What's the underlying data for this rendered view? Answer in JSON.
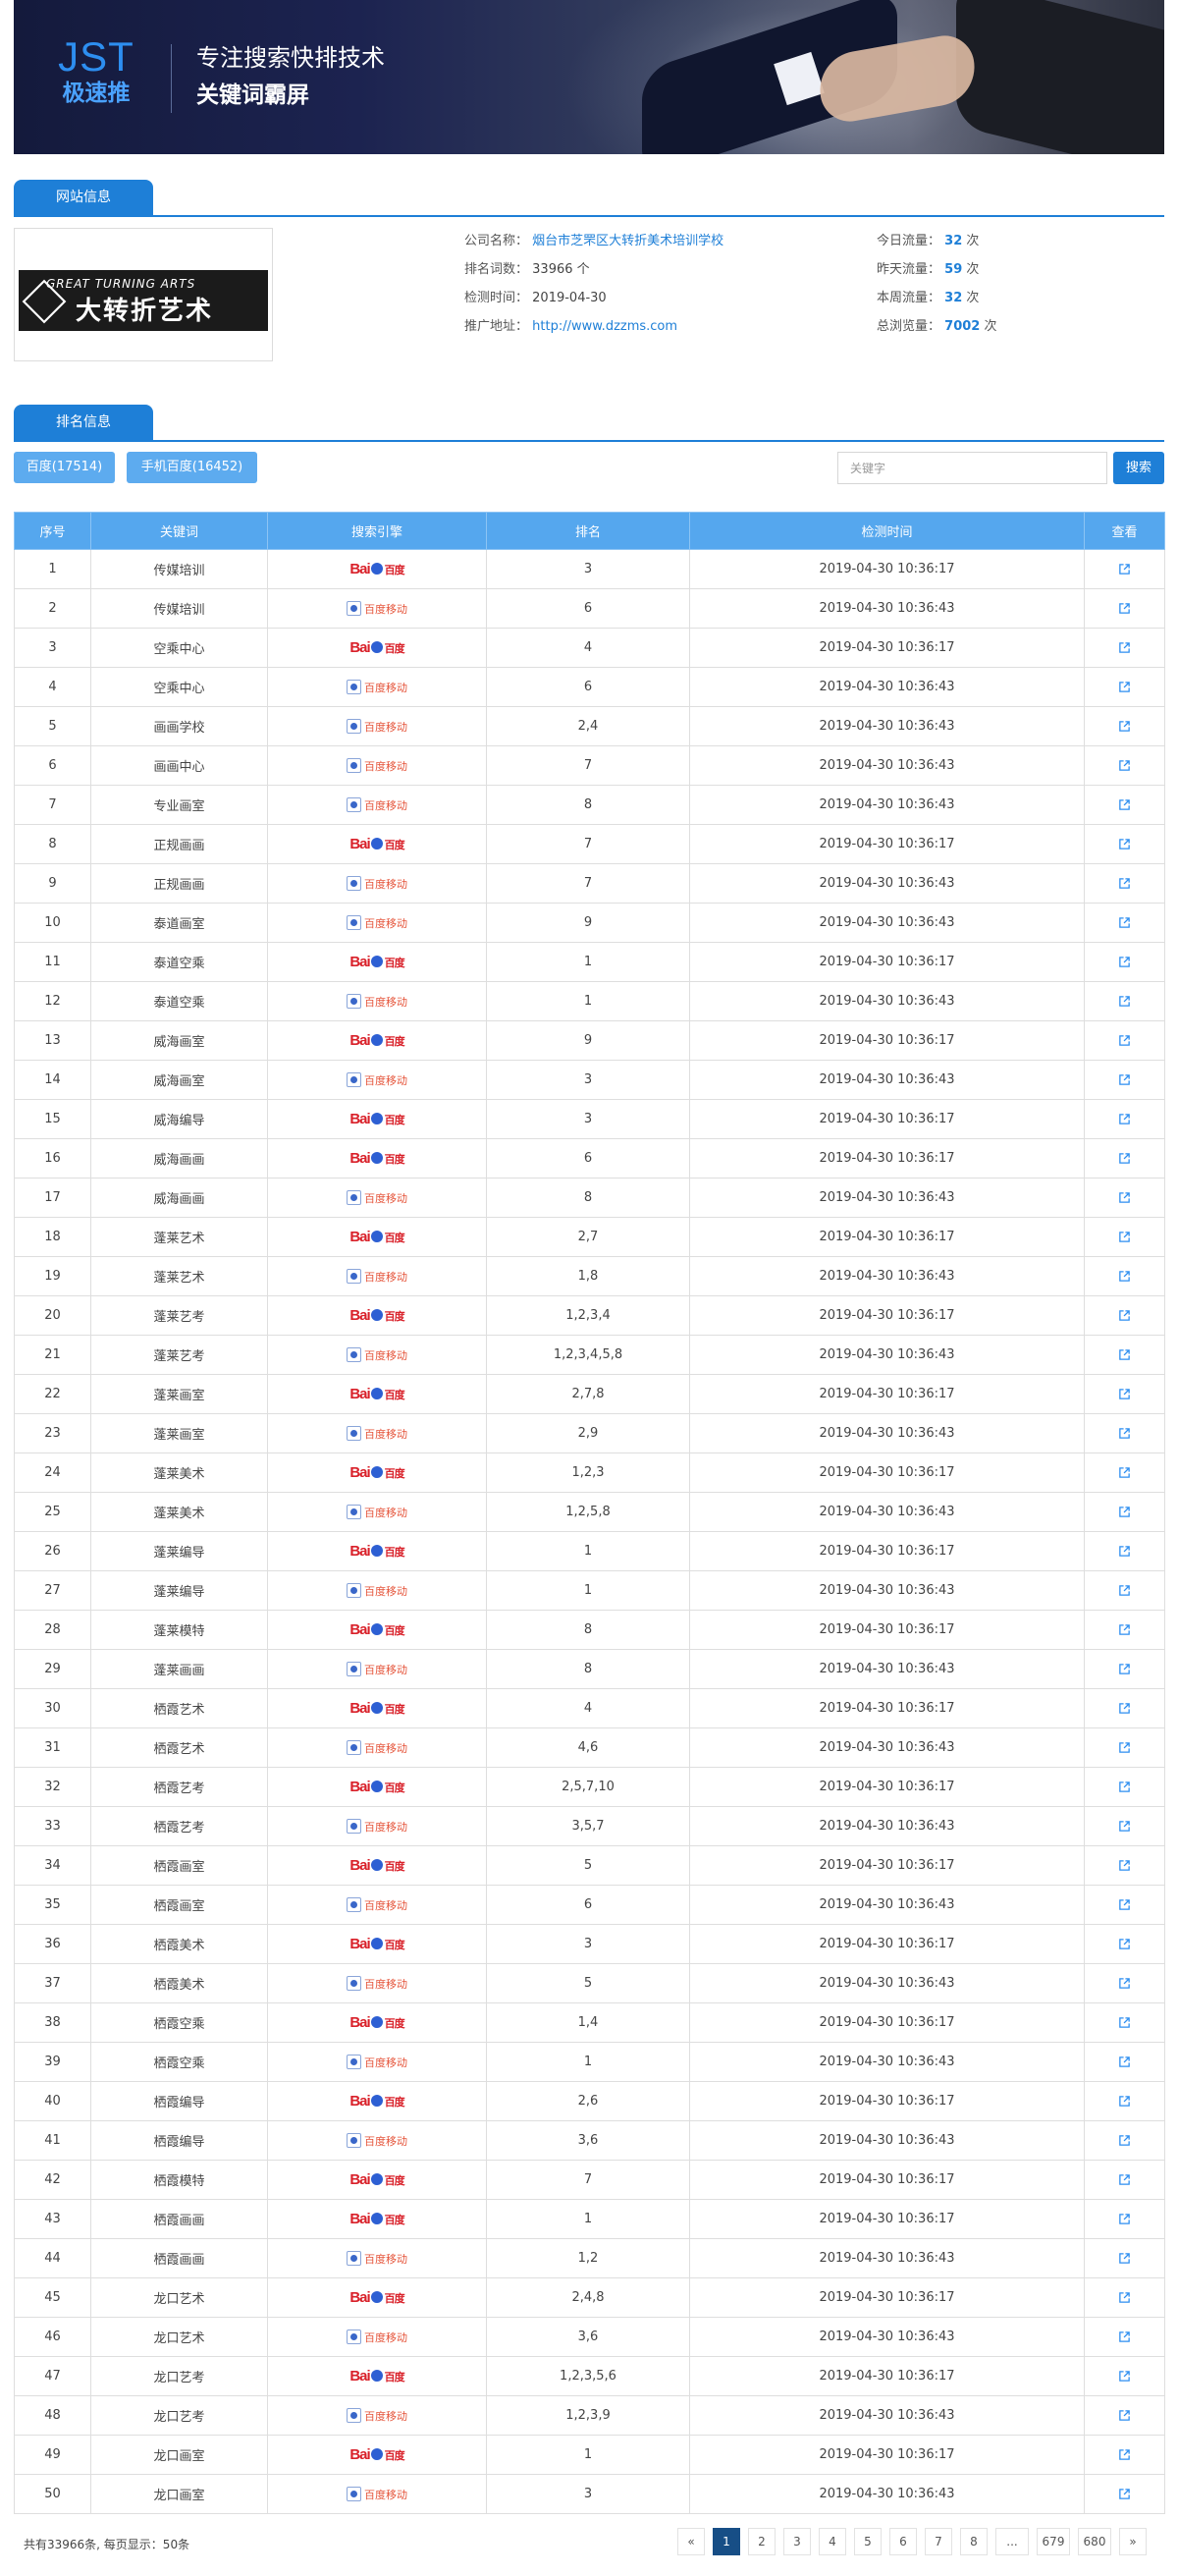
{
  "banner": {
    "logo_main": "JST",
    "logo_sub": "极速推",
    "slogan_line1": "专注搜索快排技术",
    "slogan_line2": "关键词霸屏"
  },
  "site_section": {
    "tab_label": "网站信息"
  },
  "site_logo": {
    "text_en": "GREAT TURNING ARTS",
    "text_cn": "大转折艺术"
  },
  "site_info": {
    "company_label": "公司名称：",
    "company_value": "烟台市芝罘区大转折美术培训学校",
    "rank_count_label": "排名词数：",
    "rank_count_value": "33966 个",
    "check_time_label": "检测时间：",
    "check_time_value": "2019-04-30",
    "url_label": "推广地址：",
    "url_value": "http://www.dzzms.com"
  },
  "traffic": {
    "today_label": "今日流量：",
    "today_value": "32",
    "today_unit": "次",
    "yesterday_label": "昨天流量：",
    "yesterday_value": "59",
    "yesterday_unit": "次",
    "week_label": "本周流量：",
    "week_value": "32",
    "week_unit": "次",
    "total_label": "总浏览量：",
    "total_value": "7002",
    "total_unit": "次"
  },
  "rank_section": {
    "tab_label": "排名信息"
  },
  "filters": {
    "baidu": "百度(17514)",
    "mobile": "手机百度(16452)"
  },
  "search": {
    "placeholder": "关键字",
    "button": "搜索"
  },
  "table": {
    "headers": [
      "序号",
      "关键词",
      "搜索引擎",
      "排名",
      "检测时间",
      "查看"
    ],
    "engine_labels": {
      "baidu_cn": "百度",
      "mobile_cn": "百度移动"
    },
    "rows": [
      [
        "1",
        "传媒培训",
        "baidu",
        "3",
        "2019-04-30 10:36:17"
      ],
      [
        "2",
        "传媒培训",
        "mobile",
        "6",
        "2019-04-30 10:36:43"
      ],
      [
        "3",
        "空乘中心",
        "baidu",
        "4",
        "2019-04-30 10:36:17"
      ],
      [
        "4",
        "空乘中心",
        "mobile",
        "6",
        "2019-04-30 10:36:43"
      ],
      [
        "5",
        "画画学校",
        "mobile",
        "2,4",
        "2019-04-30 10:36:43"
      ],
      [
        "6",
        "画画中心",
        "mobile",
        "7",
        "2019-04-30 10:36:43"
      ],
      [
        "7",
        "专业画室",
        "mobile",
        "8",
        "2019-04-30 10:36:43"
      ],
      [
        "8",
        "正规画画",
        "baidu",
        "7",
        "2019-04-30 10:36:17"
      ],
      [
        "9",
        "正规画画",
        "mobile",
        "7",
        "2019-04-30 10:36:43"
      ],
      [
        "10",
        "泰道画室",
        "mobile",
        "9",
        "2019-04-30 10:36:43"
      ],
      [
        "11",
        "泰道空乘",
        "baidu",
        "1",
        "2019-04-30 10:36:17"
      ],
      [
        "12",
        "泰道空乘",
        "mobile",
        "1",
        "2019-04-30 10:36:43"
      ],
      [
        "13",
        "威海画室",
        "baidu",
        "9",
        "2019-04-30 10:36:17"
      ],
      [
        "14",
        "威海画室",
        "mobile",
        "3",
        "2019-04-30 10:36:43"
      ],
      [
        "15",
        "威海编导",
        "baidu",
        "3",
        "2019-04-30 10:36:17"
      ],
      [
        "16",
        "威海画画",
        "baidu",
        "6",
        "2019-04-30 10:36:17"
      ],
      [
        "17",
        "威海画画",
        "mobile",
        "8",
        "2019-04-30 10:36:43"
      ],
      [
        "18",
        "蓬莱艺术",
        "baidu",
        "2,7",
        "2019-04-30 10:36:17"
      ],
      [
        "19",
        "蓬莱艺术",
        "mobile",
        "1,8",
        "2019-04-30 10:36:43"
      ],
      [
        "20",
        "蓬莱艺考",
        "baidu",
        "1,2,3,4",
        "2019-04-30 10:36:17"
      ],
      [
        "21",
        "蓬莱艺考",
        "mobile",
        "1,2,3,4,5,8",
        "2019-04-30 10:36:43"
      ],
      [
        "22",
        "蓬莱画室",
        "baidu",
        "2,7,8",
        "2019-04-30 10:36:17"
      ],
      [
        "23",
        "蓬莱画室",
        "mobile",
        "2,9",
        "2019-04-30 10:36:43"
      ],
      [
        "24",
        "蓬莱美术",
        "baidu",
        "1,2,3",
        "2019-04-30 10:36:17"
      ],
      [
        "25",
        "蓬莱美术",
        "mobile",
        "1,2,5,8",
        "2019-04-30 10:36:43"
      ],
      [
        "26",
        "蓬莱编导",
        "baidu",
        "1",
        "2019-04-30 10:36:17"
      ],
      [
        "27",
        "蓬莱编导",
        "mobile",
        "1",
        "2019-04-30 10:36:43"
      ],
      [
        "28",
        "蓬莱模特",
        "baidu",
        "8",
        "2019-04-30 10:36:17"
      ],
      [
        "29",
        "蓬莱画画",
        "mobile",
        "8",
        "2019-04-30 10:36:43"
      ],
      [
        "30",
        "栖霞艺术",
        "baidu",
        "4",
        "2019-04-30 10:36:17"
      ],
      [
        "31",
        "栖霞艺术",
        "mobile",
        "4,6",
        "2019-04-30 10:36:43"
      ],
      [
        "32",
        "栖霞艺考",
        "baidu",
        "2,5,7,10",
        "2019-04-30 10:36:17"
      ],
      [
        "33",
        "栖霞艺考",
        "mobile",
        "3,5,7",
        "2019-04-30 10:36:43"
      ],
      [
        "34",
        "栖霞画室",
        "baidu",
        "5",
        "2019-04-30 10:36:17"
      ],
      [
        "35",
        "栖霞画室",
        "mobile",
        "6",
        "2019-04-30 10:36:43"
      ],
      [
        "36",
        "栖霞美术",
        "baidu",
        "3",
        "2019-04-30 10:36:17"
      ],
      [
        "37",
        "栖霞美术",
        "mobile",
        "5",
        "2019-04-30 10:36:43"
      ],
      [
        "38",
        "栖霞空乘",
        "baidu",
        "1,4",
        "2019-04-30 10:36:17"
      ],
      [
        "39",
        "栖霞空乘",
        "mobile",
        "1",
        "2019-04-30 10:36:43"
      ],
      [
        "40",
        "栖霞编导",
        "baidu",
        "2,6",
        "2019-04-30 10:36:17"
      ],
      [
        "41",
        "栖霞编导",
        "mobile",
        "3,6",
        "2019-04-30 10:36:43"
      ],
      [
        "42",
        "栖霞模特",
        "baidu",
        "7",
        "2019-04-30 10:36:17"
      ],
      [
        "43",
        "栖霞画画",
        "baidu",
        "1",
        "2019-04-30 10:36:17"
      ],
      [
        "44",
        "栖霞画画",
        "mobile",
        "1,2",
        "2019-04-30 10:36:43"
      ],
      [
        "45",
        "龙口艺术",
        "baidu",
        "2,4,8",
        "2019-04-30 10:36:17"
      ],
      [
        "46",
        "龙口艺术",
        "mobile",
        "3,6",
        "2019-04-30 10:36:43"
      ],
      [
        "47",
        "龙口艺考",
        "baidu",
        "1,2,3,5,6",
        "2019-04-30 10:36:17"
      ],
      [
        "48",
        "龙口艺考",
        "mobile",
        "1,2,3,9",
        "2019-04-30 10:36:43"
      ],
      [
        "49",
        "龙口画室",
        "baidu",
        "1",
        "2019-04-30 10:36:17"
      ],
      [
        "50",
        "龙口画室",
        "mobile",
        "3",
        "2019-04-30 10:36:43"
      ]
    ]
  },
  "footer": {
    "total_text": "共有33966条, 每页显示：50条",
    "pages": [
      "«",
      "1",
      "2",
      "3",
      "4",
      "5",
      "6",
      "7",
      "8",
      "...",
      "679",
      "680",
      "»"
    ],
    "active_page": "1"
  },
  "colors": {
    "accent": "#1e7fd7",
    "header_bg": "#55a7ee",
    "filter_bg": "#5dabef",
    "active_page": "#174e86"
  }
}
